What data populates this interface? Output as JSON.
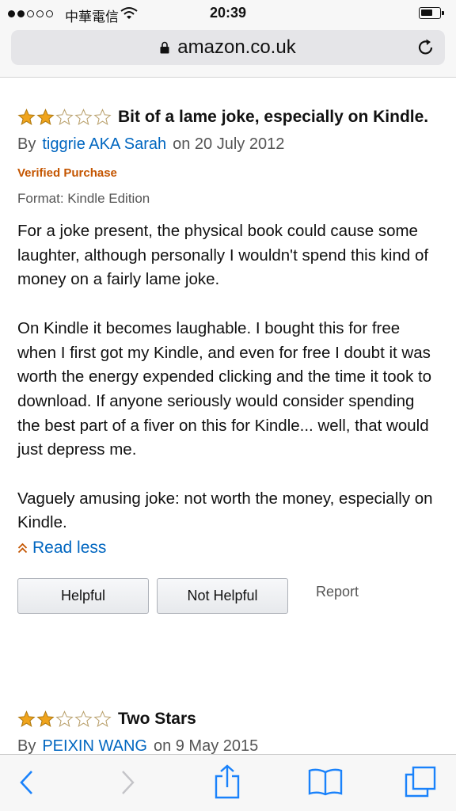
{
  "status_bar": {
    "carrier": "中華電信",
    "time": "20:39"
  },
  "browser": {
    "url": "amazon.co.uk"
  },
  "reviews": [
    {
      "rating": 2,
      "max_rating": 5,
      "title": "Bit of a lame joke, especially on Kindle.",
      "by_prefix": "By",
      "author": "tiggrie AKA Sarah",
      "date": "on 20 July 2012",
      "verified": "Verified Purchase",
      "format": "Format: Kindle Edition",
      "paragraphs": [
        "For a joke present, the physical book could cause some laughter, although personally I wouldn't spend this kind of money on a fairly lame joke.",
        "On Kindle it becomes laughable. I bought this for free when I first got my Kindle, and even for free I doubt it was worth the energy expended clicking and the time it took to download. If anyone seriously would consider spending the best part of a fiver on this for Kindle... well, that would just depress me.",
        "Vaguely amusing joke: not worth the money, especially on Kindle."
      ],
      "read_less": "Read less",
      "helpful_label": "Helpful",
      "not_helpful_label": "Not Helpful",
      "report_label": "Report"
    },
    {
      "rating": 2,
      "max_rating": 5,
      "title": "Two Stars",
      "by_prefix": "By",
      "author": "PEIXIN WANG",
      "date": "on 9 May 2015"
    }
  ],
  "colors": {
    "star_fill": "#f0a41c",
    "link": "#0066c0",
    "verified": "#c45500",
    "toolbar_icon": "#1a82fb"
  },
  "icons": [
    "lock-icon",
    "reload-icon",
    "back-icon",
    "forward-icon",
    "share-icon",
    "bookmarks-icon",
    "tabs-icon",
    "wifi-icon"
  ]
}
